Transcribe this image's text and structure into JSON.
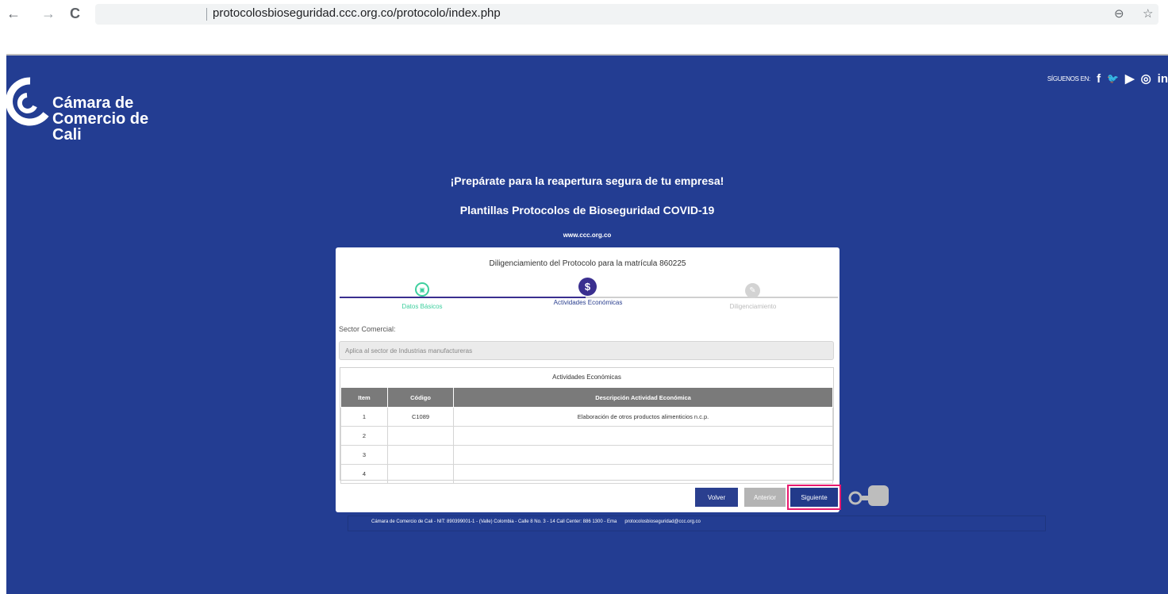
{
  "browser": {
    "url": "protocolosbioseguridad.ccc.org.co/protocolo/index.php",
    "back_icon": "←",
    "forward_icon": "→",
    "reload_icon": "C",
    "zoom_icon": "⊖",
    "star_icon": "☆"
  },
  "header": {
    "logo_line1": "Cámara de",
    "logo_line2": "Comercio de Cali",
    "social_label": "SÍGUENOS EN:",
    "social_icons": [
      "f",
      "🐦",
      "▶",
      "◎",
      "in"
    ]
  },
  "hero": {
    "title": "¡Prepárate para la reapertura segura de tu empresa!",
    "subtitle": "Plantillas Protocolos de Bioseguridad COVID-19",
    "site": "www.ccc.org.co"
  },
  "card": {
    "title": "Diligenciamiento del Protocolo para la matrícula 860225",
    "steps": [
      {
        "label": "Datos Básicos",
        "icon": "document-icon",
        "glyph": "▣"
      },
      {
        "label": "Actividades Económicas",
        "icon": "dollar-icon",
        "glyph": "$"
      },
      {
        "label": "Diligenciamiento",
        "icon": "pencil-icon",
        "glyph": "✎"
      }
    ],
    "sector_label": "Sector Comercial:",
    "sector_value": "Aplica al sector de Industrias manufactureras",
    "table": {
      "caption": "Actividades Económicas",
      "headers": [
        "Item",
        "Código",
        "Descripción Actividad Económica"
      ],
      "rows": [
        [
          "1",
          "C1089",
          "Elaboración de otros productos alimenticios n.c.p."
        ],
        [
          "2",
          "",
          ""
        ],
        [
          "3",
          "",
          ""
        ],
        [
          "4",
          "",
          ""
        ]
      ]
    },
    "buttons": {
      "back": "Volver",
      "prev": "Anterior",
      "next": "Siguiente"
    }
  },
  "footer": {
    "text": "Cámara de Comercio de Cali - NIT: 890399001-1 - (Valle) Colombia - Calle 8 No. 3 - 14 Call Center: 886 1300 - Ema",
    "email": "protocolosbioseguridad@ccc.org.co"
  },
  "colors": {
    "background": "#233d92",
    "step1": "#3ecf9e",
    "step2": "#3a2f8f",
    "step3": "#d3d3d3",
    "highlight": "#e8196e"
  }
}
